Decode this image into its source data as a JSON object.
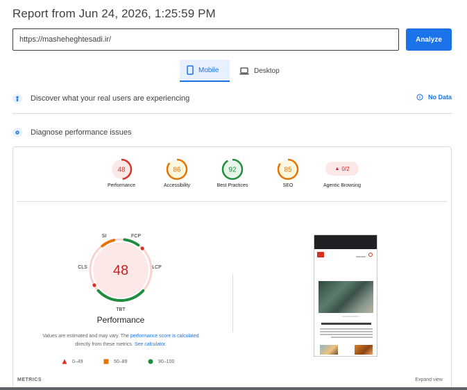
{
  "report": {
    "title": "Report from Jun 24, 2026, 1:25:59 PM"
  },
  "url_bar": {
    "value": "https://masheheghtesadi.ir/",
    "analyze_label": "Analyze"
  },
  "device_tabs": {
    "mobile": "Mobile",
    "desktop": "Desktop",
    "selected": "Mobile"
  },
  "field_data": {
    "label": "Discover what your real users are experiencing",
    "status": "No Data"
  },
  "diagnose": {
    "label": "Diagnose performance issues"
  },
  "scores": [
    {
      "label": "Performance",
      "value": "48",
      "fraction": 0.48,
      "color": "#d93025",
      "bg": "#fce8e6"
    },
    {
      "label": "Accessibility",
      "value": "86",
      "fraction": 0.86,
      "color": "#e37400",
      "bg": "#fef7e0"
    },
    {
      "label": "Best Practices",
      "value": "92",
      "fraction": 0.92,
      "color": "#1e8e3e",
      "bg": "#e6f4ea"
    },
    {
      "label": "SEO",
      "value": "85",
      "fraction": 0.85,
      "color": "#e37400",
      "bg": "#fef7e0"
    }
  ],
  "agentic": {
    "label": "Agentic Browsing",
    "value": "0/2"
  },
  "performance_detail": {
    "score": "48",
    "title": "Performance",
    "metric_labels": {
      "si": "SI",
      "fcp": "FCP",
      "lcp": "LCP",
      "tbt": "TBT",
      "cls": "CLS"
    },
    "note_part1": "Values are estimated and may vary. The ",
    "note_link1": "performance score is calculated",
    "note_part2": " directly from these metrics. ",
    "note_link2": "See calculator."
  },
  "legend": {
    "poor": "0–49",
    "average": "50–89",
    "good": "90–100"
  },
  "metrics": {
    "label": "METRICS",
    "expand": "Expand view"
  },
  "colors": {
    "accent": "#1a73e8",
    "fail": "#d93025",
    "average": "#e37400",
    "pass": "#1e8e3e"
  }
}
